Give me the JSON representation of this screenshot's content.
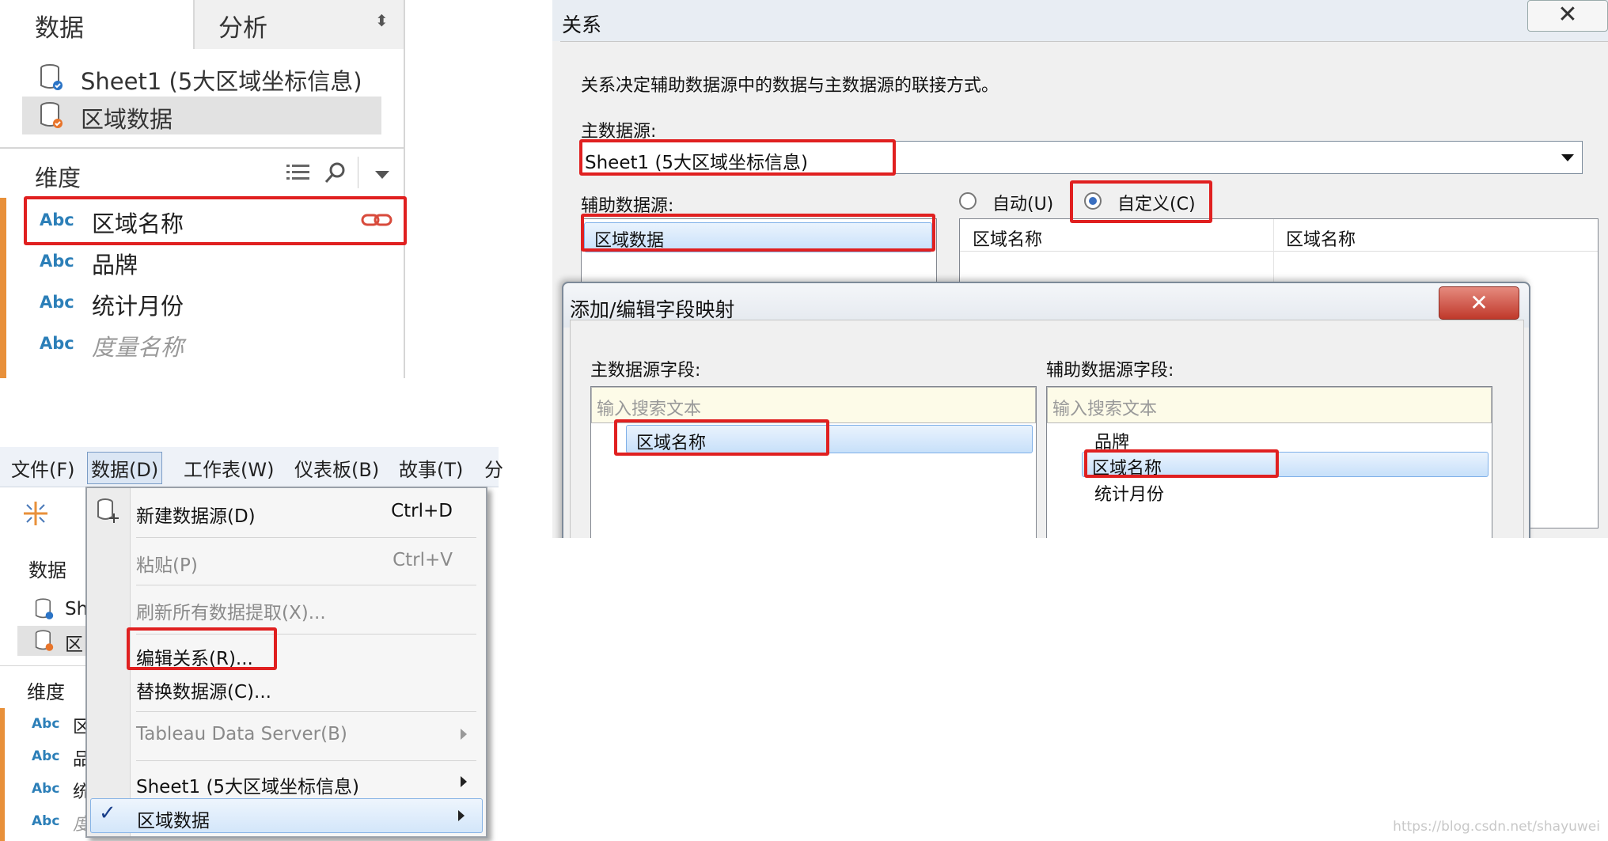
{
  "dataPane": {
    "tabs": [
      {
        "label": "数据"
      },
      {
        "label": "分析"
      }
    ],
    "sources": [
      {
        "label": "Sheet1 (5大区域坐标信息)"
      },
      {
        "label": "区域数据"
      }
    ],
    "dimensions_header": "维度",
    "abc": "Abc",
    "dimensions": [
      {
        "label": "区域名称"
      },
      {
        "label": "品牌"
      },
      {
        "label": "统计月份"
      },
      {
        "label": "度量名称"
      }
    ]
  },
  "menu": {
    "menubar": [
      "文件(F)",
      "数据(D)",
      "工作表(W)",
      "仪表板(B)",
      "故事(T)",
      "分"
    ],
    "behind": {
      "data_header": "数据",
      "src1": "Sh",
      "src2": "区",
      "dim_header": "维度",
      "abc": "Abc",
      "dim_letters": [
        "区",
        "品",
        "统",
        "度"
      ]
    },
    "items": [
      {
        "label": "新建数据源(D)",
        "shortcut": "Ctrl+D"
      },
      {
        "label": "粘贴(P)",
        "shortcut": "Ctrl+V"
      },
      {
        "label": "刷新所有数据提取(X)..."
      },
      {
        "label": "编辑关系(R)..."
      },
      {
        "label": "替换数据源(C)..."
      },
      {
        "label": "Tableau Data Server(B)"
      },
      {
        "label": "Sheet1 (5大区域坐标信息)"
      },
      {
        "label": "区域数据"
      }
    ],
    "check": "✓"
  },
  "relDialog": {
    "title": "关系",
    "close": "✕",
    "description": "关系决定辅助数据源中的数据与主数据源的联接方式。",
    "primary_label": "主数据源:",
    "primary_value": "Sheet1 (5大区域坐标信息)",
    "secondary_label": "辅助数据源:",
    "secondary_value": "区域数据",
    "radio_auto": "自动(U)",
    "radio_custom": "自定义(C)",
    "mapping_headers": [
      "区域名称",
      "区域名称"
    ],
    "inner": {
      "title": "添加/编辑字段映射",
      "close": "✕",
      "primary_field_label": "主数据源字段:",
      "secondary_field_label": "辅助数据源字段:",
      "search_placeholder": "输入搜索文本",
      "primary_fields": [
        "区域名称"
      ],
      "secondary_fields": [
        "品牌",
        "区域名称",
        "统计月份"
      ]
    }
  },
  "watermark": "https://blog.csdn.net/shayuwei"
}
